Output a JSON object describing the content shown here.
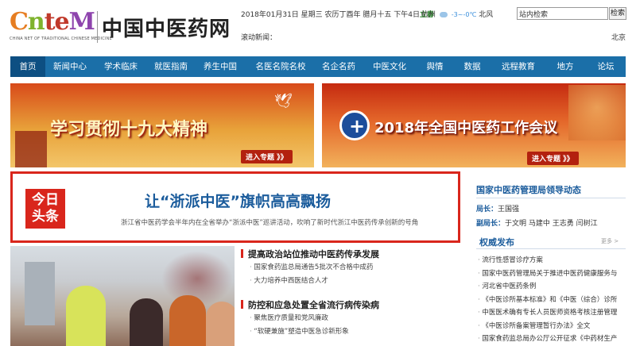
{
  "header": {
    "logo_word": "CnteM",
    "logo_sub": "CHINA NET OF TRADITIONAL CHINESE MEDICINE",
    "logo_cn": "中国中医药网",
    "date_text": "2018年01月31日 星期三 农历丁酉年 腊月十五 下午4日",
    "jieqi": "立春",
    "weather_city": "杭州",
    "weather_temp": "-3~-0℃",
    "weather_city2": "北风",
    "search_placeholder": "站内检索",
    "search_btn": "检索",
    "scroll_label": "滚动新闻：",
    "city": "北京"
  },
  "nav": [
    {
      "label": "首页",
      "icon": ""
    },
    {
      "label": "新闻中心"
    },
    {
      "label": "学术临床"
    },
    {
      "label": "就医指南"
    },
    {
      "label": "养生中国"
    },
    {
      "label": "名医名院名校"
    },
    {
      "label": "名企名药"
    },
    {
      "label": "中医文化"
    },
    {
      "label": "舆情"
    },
    {
      "label": "数据"
    },
    {
      "label": "远程教育"
    },
    {
      "label": "地方"
    },
    {
      "label": "论坛"
    }
  ],
  "banners": {
    "left_title": "学习贯彻十九大精神",
    "left_enter": "进入专题 》》",
    "right_title": "2018年全国中医药工作会议",
    "right_enter": "进入专题 》》"
  },
  "headline": {
    "badge_line1": "今日",
    "badge_line2": "头条",
    "title": "让“浙派中医”旗帜高高飘扬",
    "subtitle": "浙江省中医药学会半年内在全省举办“浙派中医”巡讲活动，吹响了新时代浙江中医药传承创新的号角"
  },
  "leaders": {
    "title": "国家中医药管理局领导动态",
    "rows": [
      {
        "role": "局长：",
        "names": "王国强"
      },
      {
        "role": "副局长：",
        "names": "于文明 马建中 王志勇 闫树江"
      }
    ]
  },
  "authority": {
    "title": "权威发布",
    "more": "更多 >",
    "items": [
      "流行性感冒诊疗方案",
      "国家中医药管理局关于推进中医药健康服务与",
      "河北省中医药条例",
      "《中医诊所基本标准》和《中医（综合）诊所",
      "中医医术确有专长人员医师资格考核注册管理",
      "《中医诊所备案管理暂行办法》全文",
      "国家食药监总局办公厅公开征求《中药材生产"
    ]
  },
  "news": [
    {
      "head": "提高政治站位推动中医药传承发展",
      "items": [
        "国家食药监总局通告5批次不合格中成药",
        "大力培养中西医结合人才"
      ]
    },
    {
      "head": "防控和应急处置全省流行病传染病",
      "items": [
        "聚焦医疗质量和党风廉政",
        "“软硬兼施”塑造中医急诊新形象"
      ]
    }
  ]
}
